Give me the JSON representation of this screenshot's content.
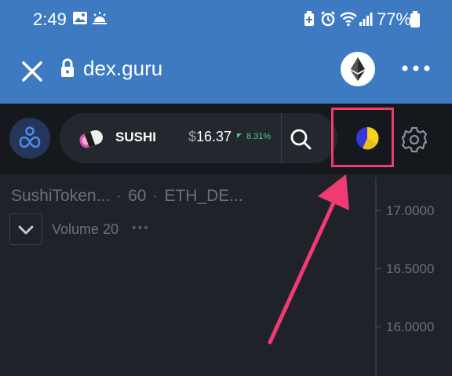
{
  "status_bar": {
    "time": "2:49",
    "battery_percent": "77%"
  },
  "browser": {
    "url": "dex.guru"
  },
  "header": {
    "token": {
      "symbol": "SUSHI",
      "price_currency": "$",
      "price_value": "16.37",
      "change": "8.31%"
    }
  },
  "chart": {
    "legend_name": "SushiToken...",
    "legend_interval": "60",
    "legend_pair": "ETH_DE...",
    "volume_label": "Volume 20",
    "volume_more": "•••",
    "price_labels": [
      "17.0000",
      "16.5000",
      "16.0000"
    ]
  },
  "colors": {
    "browser_bar": "#3d7ac2",
    "app_header": "#15181d",
    "chart_bg": "#1f2329",
    "highlight": "#ef3d6e",
    "positive": "#3fd18b"
  }
}
